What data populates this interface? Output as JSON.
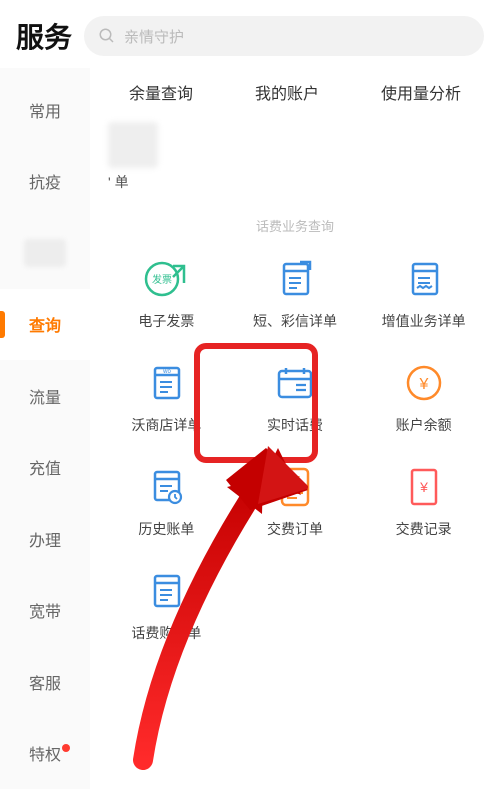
{
  "header": {
    "title": "服务",
    "search_placeholder": "亲情守护"
  },
  "sidebar": {
    "items": [
      {
        "label": "常用"
      },
      {
        "label": "抗疫"
      },
      {
        "label": ""
      },
      {
        "label": "查询",
        "active": true
      },
      {
        "label": "流量"
      },
      {
        "label": "充值"
      },
      {
        "label": "办理"
      },
      {
        "label": "宽带"
      },
      {
        "label": "客服"
      },
      {
        "label": "特权",
        "dot": true
      }
    ]
  },
  "tabs": [
    {
      "label": "余量查询"
    },
    {
      "label": "我的账户"
    },
    {
      "label": "使用量分析"
    }
  ],
  "recent": {
    "caption": "' 单"
  },
  "section": {
    "title": "话费业务查询"
  },
  "grid": [
    {
      "label": "电子发票",
      "icon": "invoice"
    },
    {
      "label": "短、彩信详单",
      "icon": "sms"
    },
    {
      "label": "增值业务详单",
      "icon": "vas"
    },
    {
      "label": "沃商店详单",
      "icon": "wo"
    },
    {
      "label": "实时话费",
      "icon": "realtime",
      "highlight": true
    },
    {
      "label": "账户余额",
      "icon": "balance"
    },
    {
      "label": "历史账单",
      "icon": "history"
    },
    {
      "label": "交费订单",
      "icon": "order"
    },
    {
      "label": "交费记录",
      "icon": "record"
    },
    {
      "label": "话费购详单",
      "icon": "buy"
    }
  ],
  "colors": {
    "accent": "#ff7a00",
    "highlight": "#e62323",
    "blue": "#3b8de0",
    "green": "#2fbf8f",
    "orange": "#ff8a2a",
    "red": "#ff5a5a"
  }
}
